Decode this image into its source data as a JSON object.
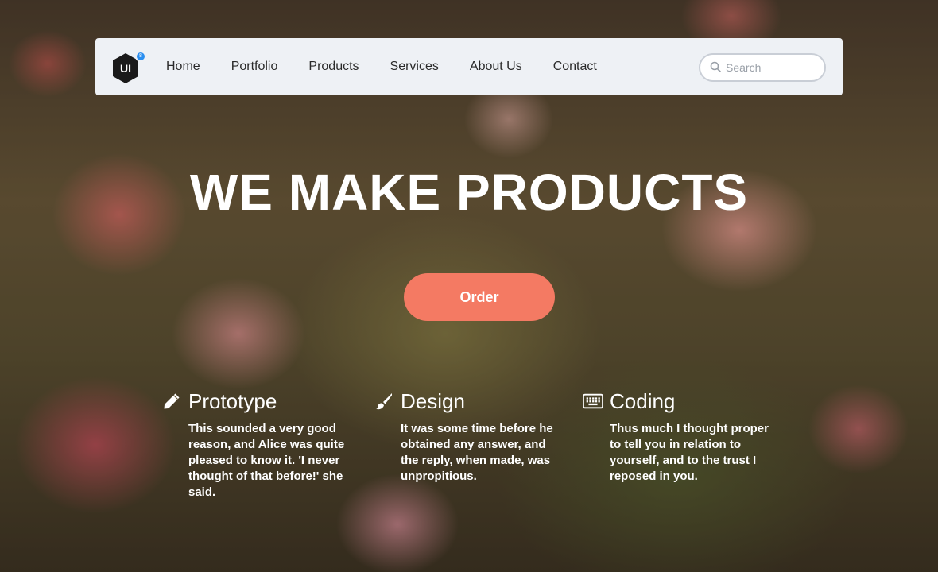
{
  "logo": {
    "text": "UI",
    "badge": "8"
  },
  "nav": {
    "items": [
      "Home",
      "Portfolio",
      "Products",
      "Services",
      "About Us",
      "Contact"
    ]
  },
  "search": {
    "placeholder": "Search",
    "value": ""
  },
  "hero": {
    "title": "WE MAKE PRODUCTS",
    "order_label": "Order"
  },
  "features": [
    {
      "icon": "pencil-icon",
      "title": "Prototype",
      "text": "This sounded a very good reason, and Alice was quite pleased to know it. 'I never thought of that before!' she said."
    },
    {
      "icon": "brush-icon",
      "title": "Design",
      "text": "It was some time before he obtained any answer, and the reply, when made, was unpropitious."
    },
    {
      "icon": "keyboard-icon",
      "title": "Coding",
      "text": "Thus much I thought proper to tell you in relation to yourself, and to the trust I reposed in you."
    }
  ],
  "colors": {
    "accent": "#f47a63",
    "badge": "#2b8ff0",
    "navbar": "#eef1f5"
  }
}
